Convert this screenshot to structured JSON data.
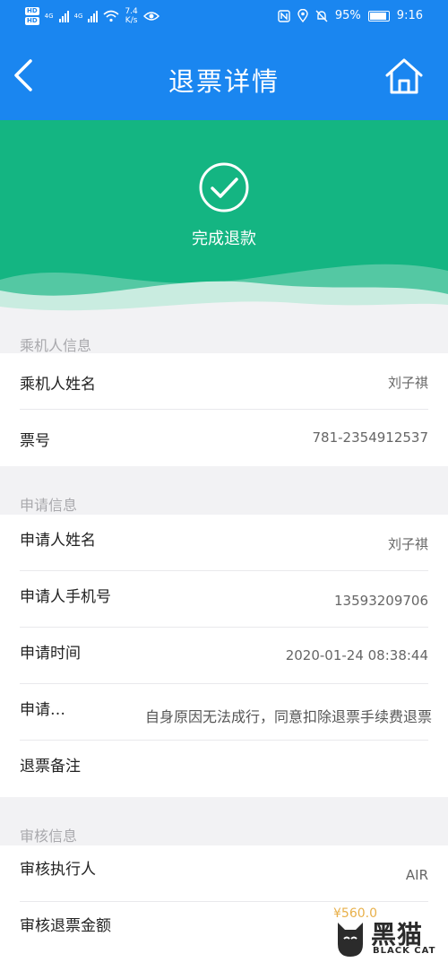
{
  "status_bar": {
    "speed_value": "7.4",
    "speed_unit": "K/s",
    "signal_label": "4G",
    "battery_text": "95%",
    "time": "9:16"
  },
  "nav": {
    "title": "退票详情"
  },
  "hero": {
    "status_text": "完成退款"
  },
  "passenger_section": {
    "header": "乘机人信息",
    "rows": [
      {
        "label": "乘机人姓名",
        "value": "刘子祺"
      },
      {
        "label": "票号",
        "value": "781-2354912537"
      }
    ]
  },
  "application_section": {
    "header": "申请信息",
    "rows": [
      {
        "label": "申请人姓名",
        "value": "刘子祺"
      },
      {
        "label": "申请人手机号",
        "value": "13593209706"
      },
      {
        "label": "申请时间",
        "value": "2020-01-24 08:38:44"
      },
      {
        "label": "申请…",
        "value": "自身原因无法成行，同意扣除退票手续费退票"
      },
      {
        "label": "退票备注",
        "value": ""
      }
    ]
  },
  "review_section": {
    "header": "审核信息",
    "rows": [
      {
        "label": "审核执行人",
        "value": "AIR"
      },
      {
        "label": "审核退票金额",
        "value": ""
      }
    ]
  },
  "watermark": {
    "amount": "¥560.0",
    "brand_cn": "黑猫",
    "brand_en": "BLACK CAT"
  },
  "colors": {
    "nav_blue": "#1a86f0",
    "hero_green": "#14b582"
  }
}
